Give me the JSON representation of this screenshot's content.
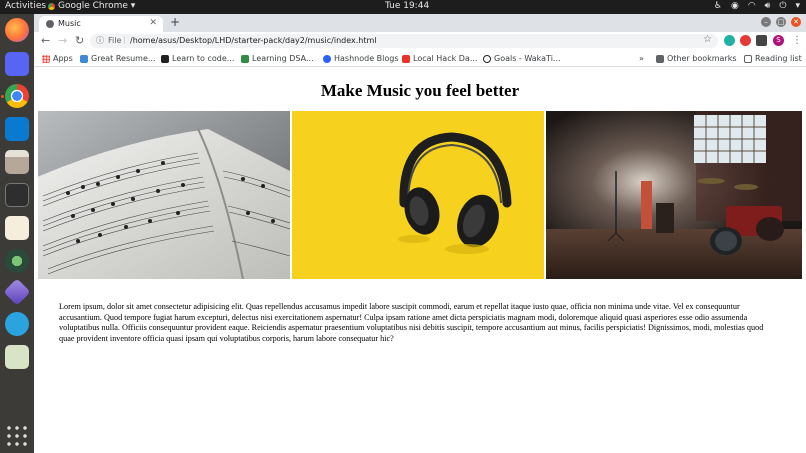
{
  "topbar": {
    "activities": "Activities",
    "app_name": "Google Chrome ▾",
    "clock": "Tue 19:44"
  },
  "dock": {
    "icons": [
      "firefox-icon",
      "discord-icon",
      "chrome-icon",
      "vscode-icon",
      "files-icon",
      "terminal-icon",
      "text-editor-icon",
      "webcam-icon",
      "obsidian-icon",
      "telegram-icon",
      "image-viewer-icon",
      "show-apps-icon"
    ]
  },
  "browser": {
    "tab_title": "Music",
    "url_scheme": "File",
    "url": "/home/asus/Desktop/LHD/starter-pack/day2/music/index.html",
    "bookmarks": [
      "Apps",
      "Great Resume...",
      "Learn to code...",
      "Learning DSA...",
      "Hashnode Blogs",
      "Local Hack Da...",
      "Goals - WakaTi..."
    ],
    "other_bookmarks": "Other bookmarks",
    "reading_list": "Reading list",
    "profile_initial": "S"
  },
  "page": {
    "heading": "Make Music you feel better",
    "images": [
      "sheet-music-photo",
      "headphones-photo",
      "music-stage-photo"
    ],
    "paragraph": "Lorem ipsum, dolor sit amet consectetur adipisicing elit. Quas repellendus accusamus impedit labore suscipit commodi, earum et repellat itaque iusto quae, officia non minima unde vitae. Vel ex consequuntur accusantium. Quod tempore fugiat harum excepturi, delectus nisi exercitationem aspernatur! Culpa ipsam ratione amet dicta perspiciatis magnam modi, doloremque aliquid quasi asperiores esse odio assumenda voluptatibus nulla. Officiis consequuntur provident eaque. Reiciendis aspernatur praesentium voluptatibus nisi debitis suscipit, tempore accusantium aut minus, facilis perspiciatis! Dignissimos, modi, molestias quod quae provident inventore officia quasi ipsam qui voluptatibus corporis, harum labore consequatur hic?"
  },
  "colors": {
    "accent": "#e95420",
    "headphones_bg": "#f7d21e",
    "dock_bg": "#3c3b37"
  }
}
